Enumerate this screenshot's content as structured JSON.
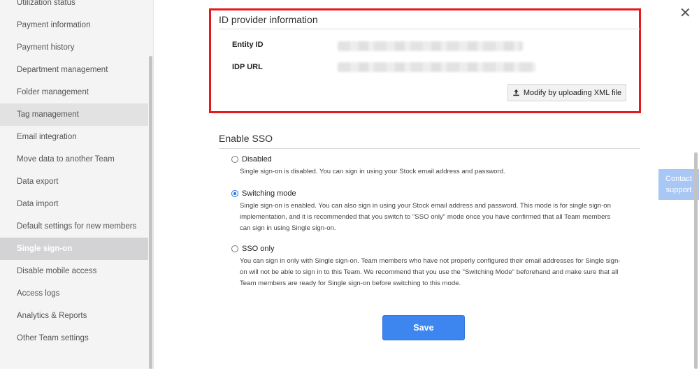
{
  "sidebar": {
    "items": [
      {
        "label": "Utilization status",
        "state": "normal"
      },
      {
        "label": "Payment information",
        "state": "normal"
      },
      {
        "label": "Payment history",
        "state": "normal"
      },
      {
        "label": "Department management",
        "state": "normal"
      },
      {
        "label": "Folder management",
        "state": "normal"
      },
      {
        "label": "Tag management",
        "state": "hover"
      },
      {
        "label": "Email integration",
        "state": "normal"
      },
      {
        "label": "Move data to another Team",
        "state": "normal"
      },
      {
        "label": "Data export",
        "state": "normal"
      },
      {
        "label": "Data import",
        "state": "normal"
      },
      {
        "label": "Default settings for new members",
        "state": "normal"
      },
      {
        "label": "Single sign-on",
        "state": "active"
      },
      {
        "label": "Disable mobile access",
        "state": "normal"
      },
      {
        "label": "Access logs",
        "state": "normal"
      },
      {
        "label": "Analytics & Reports",
        "state": "normal"
      },
      {
        "label": "Other Team settings",
        "state": "normal"
      }
    ]
  },
  "close_icon": "close-icon",
  "idp": {
    "title": "ID provider information",
    "entity_id_label": "Entity ID",
    "idp_url_label": "IDP URL",
    "upload_button_label": "Modify by uploading XML file",
    "upload_icon": "upload-icon",
    "highlight_color": "#e8191e"
  },
  "sso": {
    "title": "Enable SSO",
    "options": [
      {
        "label": "Disabled",
        "checked": false,
        "description": "Single sign-on is disabled. You can sign in using your Stock email address and password."
      },
      {
        "label": "Switching mode",
        "checked": true,
        "description": "Single sign-on is enabled. You can also sign in using your Stock email address and password. This mode is for single sign-on implementation, and it is recommended that you switch to \"SSO only\" mode once you have confirmed that all Team members can sign in using Single sign-on."
      },
      {
        "label": "SSO only",
        "checked": false,
        "description": "You can sign in only with Single sign-on. Team members who have not properly configured their email addresses for Single sign-on will not be able to sign in to this Team. We recommend that you use the \"Switching Mode\" beforehand and make sure that all Team members are ready for Single sign-on before switching to this mode."
      }
    ]
  },
  "save_label": "Save",
  "contact": {
    "line1": "Contact",
    "line2": "support"
  },
  "colors": {
    "accent": "#3d86f0",
    "active_nav": "#d3d3d6",
    "contact_bg": "#a9c7f4"
  }
}
